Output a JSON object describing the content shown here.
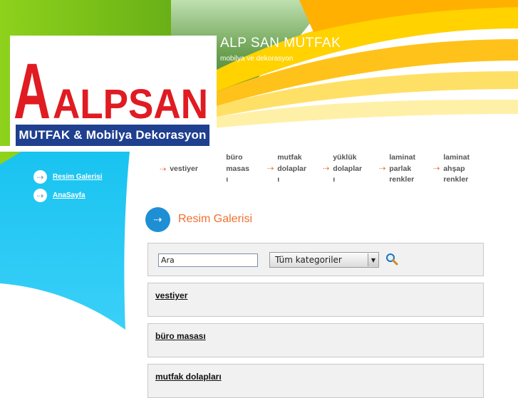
{
  "header": {
    "title": "ALP SAN MUTFAK",
    "subtitle": "mobilya ve dekorasyon"
  },
  "logo": {
    "wordmark": "ALPSAN",
    "tagline": "MUTFAK & Mobilya Dekorasyon"
  },
  "sidebar": {
    "items": [
      {
        "label": "Resim Galerisi",
        "icon": "arrow-right-icon"
      },
      {
        "label": "AnaSayfa",
        "icon": "arrow-right-icon"
      }
    ]
  },
  "nav": {
    "items": [
      {
        "lines": [
          "vestiyer"
        ]
      },
      {
        "lines": [
          "büro",
          "masas",
          "ı"
        ]
      },
      {
        "lines": [
          "mutfak",
          "dolaplar",
          "ı"
        ]
      },
      {
        "lines": [
          "yüklük",
          "dolaplar",
          "ı"
        ]
      },
      {
        "lines": [
          "laminat",
          "parlak",
          "renkler"
        ]
      },
      {
        "lines": [
          "laminat",
          "ahşap",
          "renkler"
        ]
      }
    ]
  },
  "page": {
    "heading": "Resim Galerisi",
    "heading_icon": "arrow-right-circle-icon"
  },
  "search": {
    "input_value": "Ara",
    "category_selected": "Tüm kategoriler",
    "button_icon": "magnifier-icon"
  },
  "categories": [
    {
      "label": "vestiyer"
    },
    {
      "label": "büro masası"
    },
    {
      "label": "mutfak dolapları"
    }
  ],
  "colors": {
    "accent_orange": "#f07030",
    "accent_blue": "#1e8fd5",
    "logo_red": "#e01b22",
    "logo_navy": "#1f3f8f",
    "sidebar_cyan": "#19c3f0"
  }
}
